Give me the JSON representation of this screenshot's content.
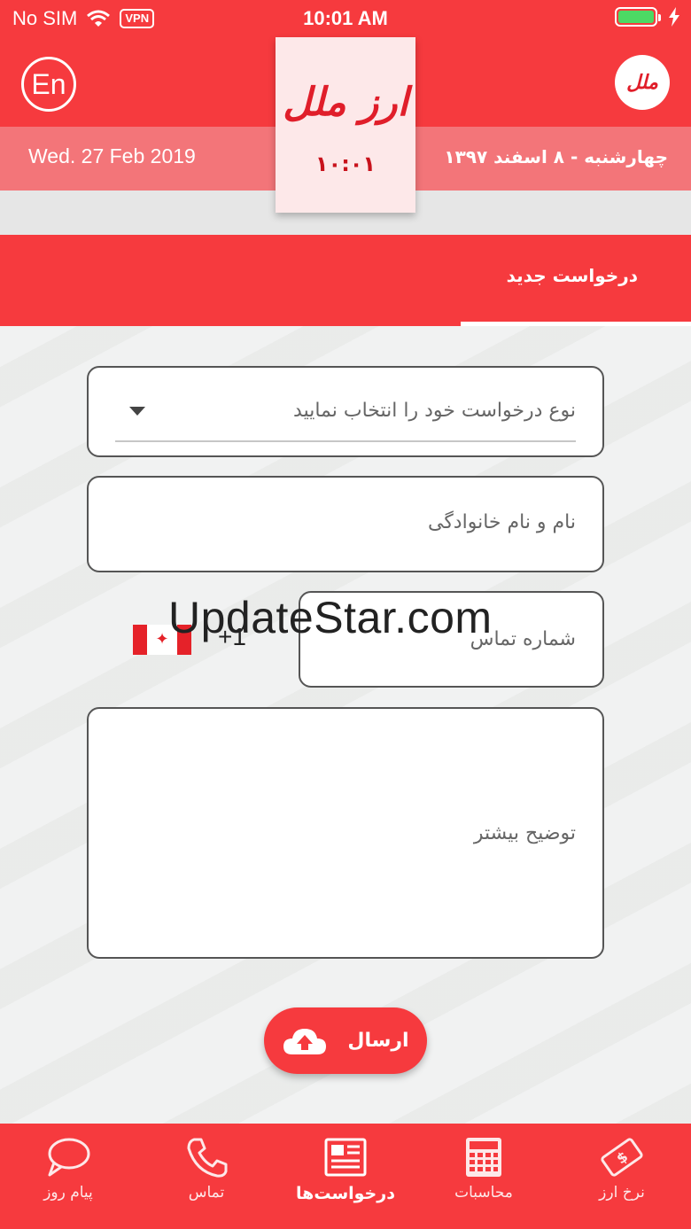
{
  "status_bar": {
    "carrier": "No SIM",
    "vpn": "VPN",
    "time": "10:01 AM"
  },
  "header": {
    "lang_button": "En",
    "logo_text": "ارز ملل",
    "logo_short": "ملل",
    "logo_time": "۱۰:۰۱",
    "date_en": "Wed. 27 Feb 2019",
    "date_fa": "چهارشنبه - ۸ اسفند ۱۳۹۷"
  },
  "tabs": {
    "active_label": "درخواست جدید"
  },
  "form": {
    "request_type_placeholder": "نوع درخواست خود را انتخاب نمایید",
    "name_placeholder": "نام و نام خانوادگی",
    "phone_placeholder": "شماره تماس",
    "dial_code": "+1",
    "description_placeholder": "توضیح بیشتر",
    "submit_label": "ارسال"
  },
  "watermark": "UpdateStar.com",
  "bottom_nav": {
    "items": [
      {
        "label": "پیام روز",
        "icon": "chat-bubble-icon"
      },
      {
        "label": "تماس",
        "icon": "phone-icon"
      },
      {
        "label": "درخواست‌ها",
        "icon": "document-icon"
      },
      {
        "label": "محاسبات",
        "icon": "calculator-icon"
      },
      {
        "label": "نرخ ارز",
        "icon": "currency-note-icon"
      }
    ],
    "active_index": 2
  },
  "colors": {
    "primary_red": "#f63a3e",
    "date_bar": "#f37579",
    "logo_card": "#fde8e9"
  }
}
